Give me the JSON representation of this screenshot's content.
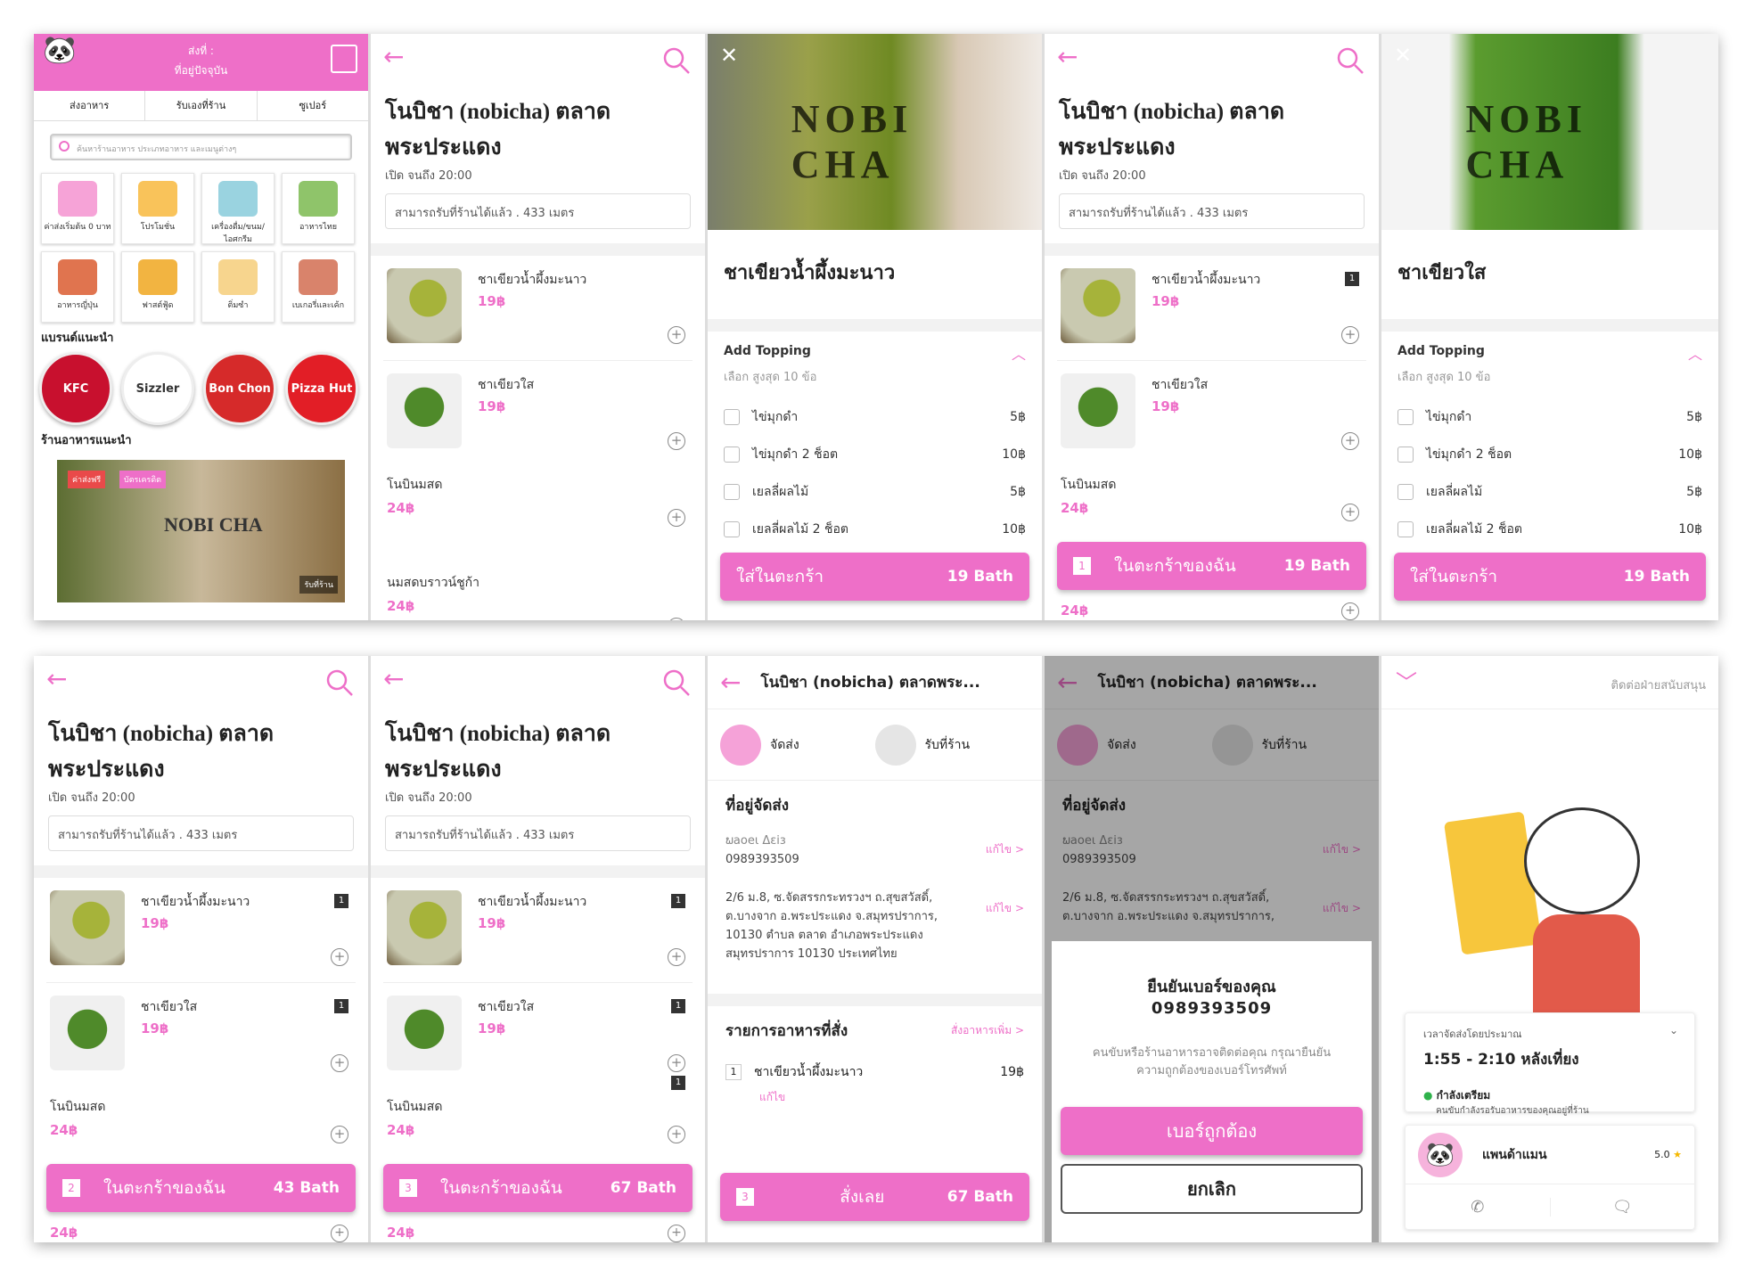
{
  "colors": {
    "accent": "#ee6fc8"
  },
  "home": {
    "header_line1": "ส่งที่ :",
    "header_line2": "ที่อยู่ปัจจุบัน",
    "tabs": [
      "ส่งอาหาร",
      "รับเองที่ร้าน",
      "ซูเปอร์"
    ],
    "search_placeholder": "ค้นหาร้านอาหาร ประเภทอาหาร และเมนูต่างๆ",
    "categories": [
      "ค่าส่งเริ่มต้น 0 บาท",
      "โปรโมชั่น",
      "เครื่องดื่ม/ขนม/ไอศกรีม",
      "อาหารไทย",
      "อาหารญี่ปุ่น",
      "ฟาสต์ฟู้ด",
      "ติ่มซำ",
      "เบเกอรี่และเค้ก"
    ],
    "brands_title": "แบรนด์แนะนำ",
    "brands": [
      "KFC",
      "Sizzler",
      "Bon Chon",
      "Pizza Hut"
    ],
    "restaurants_title": "ร้านอาหารแนะนำ",
    "promo_tags": [
      "ค่าส่งฟรี",
      "บัตรเครดิต"
    ],
    "promo_badge": "รับที่ร้าน",
    "promo_brand": "NOBI CHA"
  },
  "shop": {
    "title_line1": "โนบิชา (nobicha) ตลาด",
    "title_line2": "พระประแดง",
    "open": "เปิด  จนถึง 20:00",
    "pickup": "สามารถรับที่ร้านได้แล้ว  .  433 เมตร",
    "items": [
      {
        "name": "ชาเขียวน้ำผึ้งมะนาว",
        "price": "19฿"
      },
      {
        "name": "ชาเขียวใส",
        "price": "19฿"
      },
      {
        "name": "โนบินมสด",
        "price": "24฿"
      },
      {
        "name": "นมสดบราวน์ชูก้า",
        "price": "24฿"
      }
    ],
    "plus": "+"
  },
  "product1": {
    "name": "ชาเขียวน้ำผึ้งมะนาว",
    "brand": "NOBI CHA"
  },
  "product2": {
    "name": "ชาเขียวใส",
    "brand": "NOBI CHA"
  },
  "topping": {
    "title": "Add Topping",
    "sub": "เลือก สูงสุด 10 ข้อ",
    "options": [
      {
        "name": "ไข่มุกดำ",
        "price": "5฿"
      },
      {
        "name": "ไข่มุกดำ 2 ช็อต",
        "price": "10฿"
      },
      {
        "name": "เยลลี่ผลไม้",
        "price": "5฿"
      },
      {
        "name": "เยลลี่ผลไม้ 2 ช็อต",
        "price": "10฿"
      }
    ]
  },
  "add_cart": {
    "label": "ใส่ในตะกร้า",
    "amount": "19 Bath"
  },
  "cart_states": [
    {
      "count": "1",
      "label": "ในตะกร้าของฉัน",
      "amount": "19 Bath"
    },
    {
      "count": "2",
      "label": "ในตะกร้าของฉัน",
      "amount": "43 Bath"
    },
    {
      "count": "3",
      "label": "ในตะกร้าของฉัน",
      "amount": "67 Bath"
    }
  ],
  "qty_marks": [
    "1",
    "1",
    "1",
    "1",
    "1"
  ],
  "checkout": {
    "title": "โนบิชา (nobicha) ตลาดพระ...",
    "mode_delivery": "จัดส่ง",
    "mode_pickup": "รับที่ร้าน",
    "addr_title": "ที่อยู่จัดส่ง",
    "name": "ພaoeι Δεiɜ",
    "phone": "0989393509",
    "addr": [
      "2/6 ม.8, ซ.จัดสรรกระทรวงฯ ถ.สุขสวัสดิ์,",
      "ต.บางจาก อ.พระประแดง จ.สมุทรปราการ,",
      "10130 ตำบล ตลาด อำเภอพระประแดง",
      "สมุทรปราการ 10130 ประเทศไทย"
    ],
    "edit": "แก้ไข  >",
    "order_title": "รายการอาหารที่สั่ง",
    "order_more": "สั่งอาหารเพิ่ม  >",
    "order_item": {
      "qty": "1",
      "name": "ชาเขียวน้ำผึ้งมะนาว",
      "price": "19฿",
      "edit": "แก้ไข"
    },
    "order_bar": {
      "count": "3",
      "label": "สั่งเลย",
      "amount": "67 Bath"
    }
  },
  "confirm": {
    "title": "ยืนยันเบอร์ของคุณ",
    "phone": "0989393509",
    "desc": "คนขับหรือร้านอาหารอาจติดต่อคุณ กรุณายืนยันความถูกต้องของเบอร์โทรศัพท์",
    "ok": "เบอร์ถูกต้อง",
    "cancel": "ยกเลิก"
  },
  "tracking": {
    "contact": "ติดต่อฝ่ายสนับสนุน",
    "eta_label": "เวลาจัดส่งโดยประมาณ",
    "eta": "1:55 - 2:10 หลังเที่ยง",
    "status": "กำลังเตรียม",
    "status_desc": "คนขับกำลังรอรับอาหารของคุณอยู่ที่ร้าน",
    "driver": "แพนด้าแมน",
    "rating": "5.0"
  }
}
